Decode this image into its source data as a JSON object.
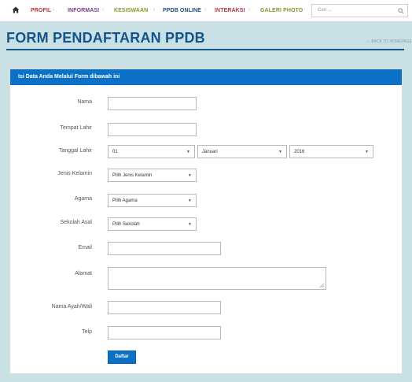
{
  "nav": {
    "items": [
      {
        "label": "PROFIL",
        "color": "#b8323f"
      },
      {
        "label": "INFORMASI",
        "color": "#7a3a8c"
      },
      {
        "label": "KESISWAAN",
        "color": "#7f9a2a"
      },
      {
        "label": "PPDB ONLINE",
        "color": "#1a4f84"
      },
      {
        "label": "INTERAKSI",
        "color": "#b8323f"
      },
      {
        "label": "GALERI PHOTO",
        "color": "#7f9a2a"
      }
    ],
    "search_placeholder": "Cari ...",
    "home_icon": "home-icon",
    "search_icon": "search-icon"
  },
  "header": {
    "title": "FORM PENDAFTARAN PPDB",
    "back_link": "BACK TO HOMEPAGE"
  },
  "form": {
    "panel_title": "Isi Data Anda Melalui Form dibawah ini",
    "labels": {
      "nama": "Nama",
      "tempat_lahir": "Tempat Lahir",
      "tanggal_lahir": "Tanggal Lahir",
      "jenis_kelamin": "Jenis Kelamin",
      "agama": "Agama",
      "sekolah_asal": "Sekolah Asal",
      "email": "Email",
      "alamat": "Alamat",
      "nama_ayah": "Nama Ayah/Wali",
      "telp": "Telp"
    },
    "values": {
      "nama": "",
      "tempat_lahir": "",
      "email": "",
      "alamat": "",
      "nama_ayah": "",
      "telp": ""
    },
    "selects": {
      "tanggal": "01",
      "bulan": "Januari",
      "tahun": "2016",
      "jenis_kelamin": "Pilih Jenis Kelamin",
      "agama": "Pilih Agama",
      "sekolah_asal": "Pilih Sekolah"
    },
    "submit_label": "Daftar"
  },
  "colors": {
    "accent": "#0b71c6",
    "title": "#14548a",
    "background": "#c9e1e5"
  }
}
